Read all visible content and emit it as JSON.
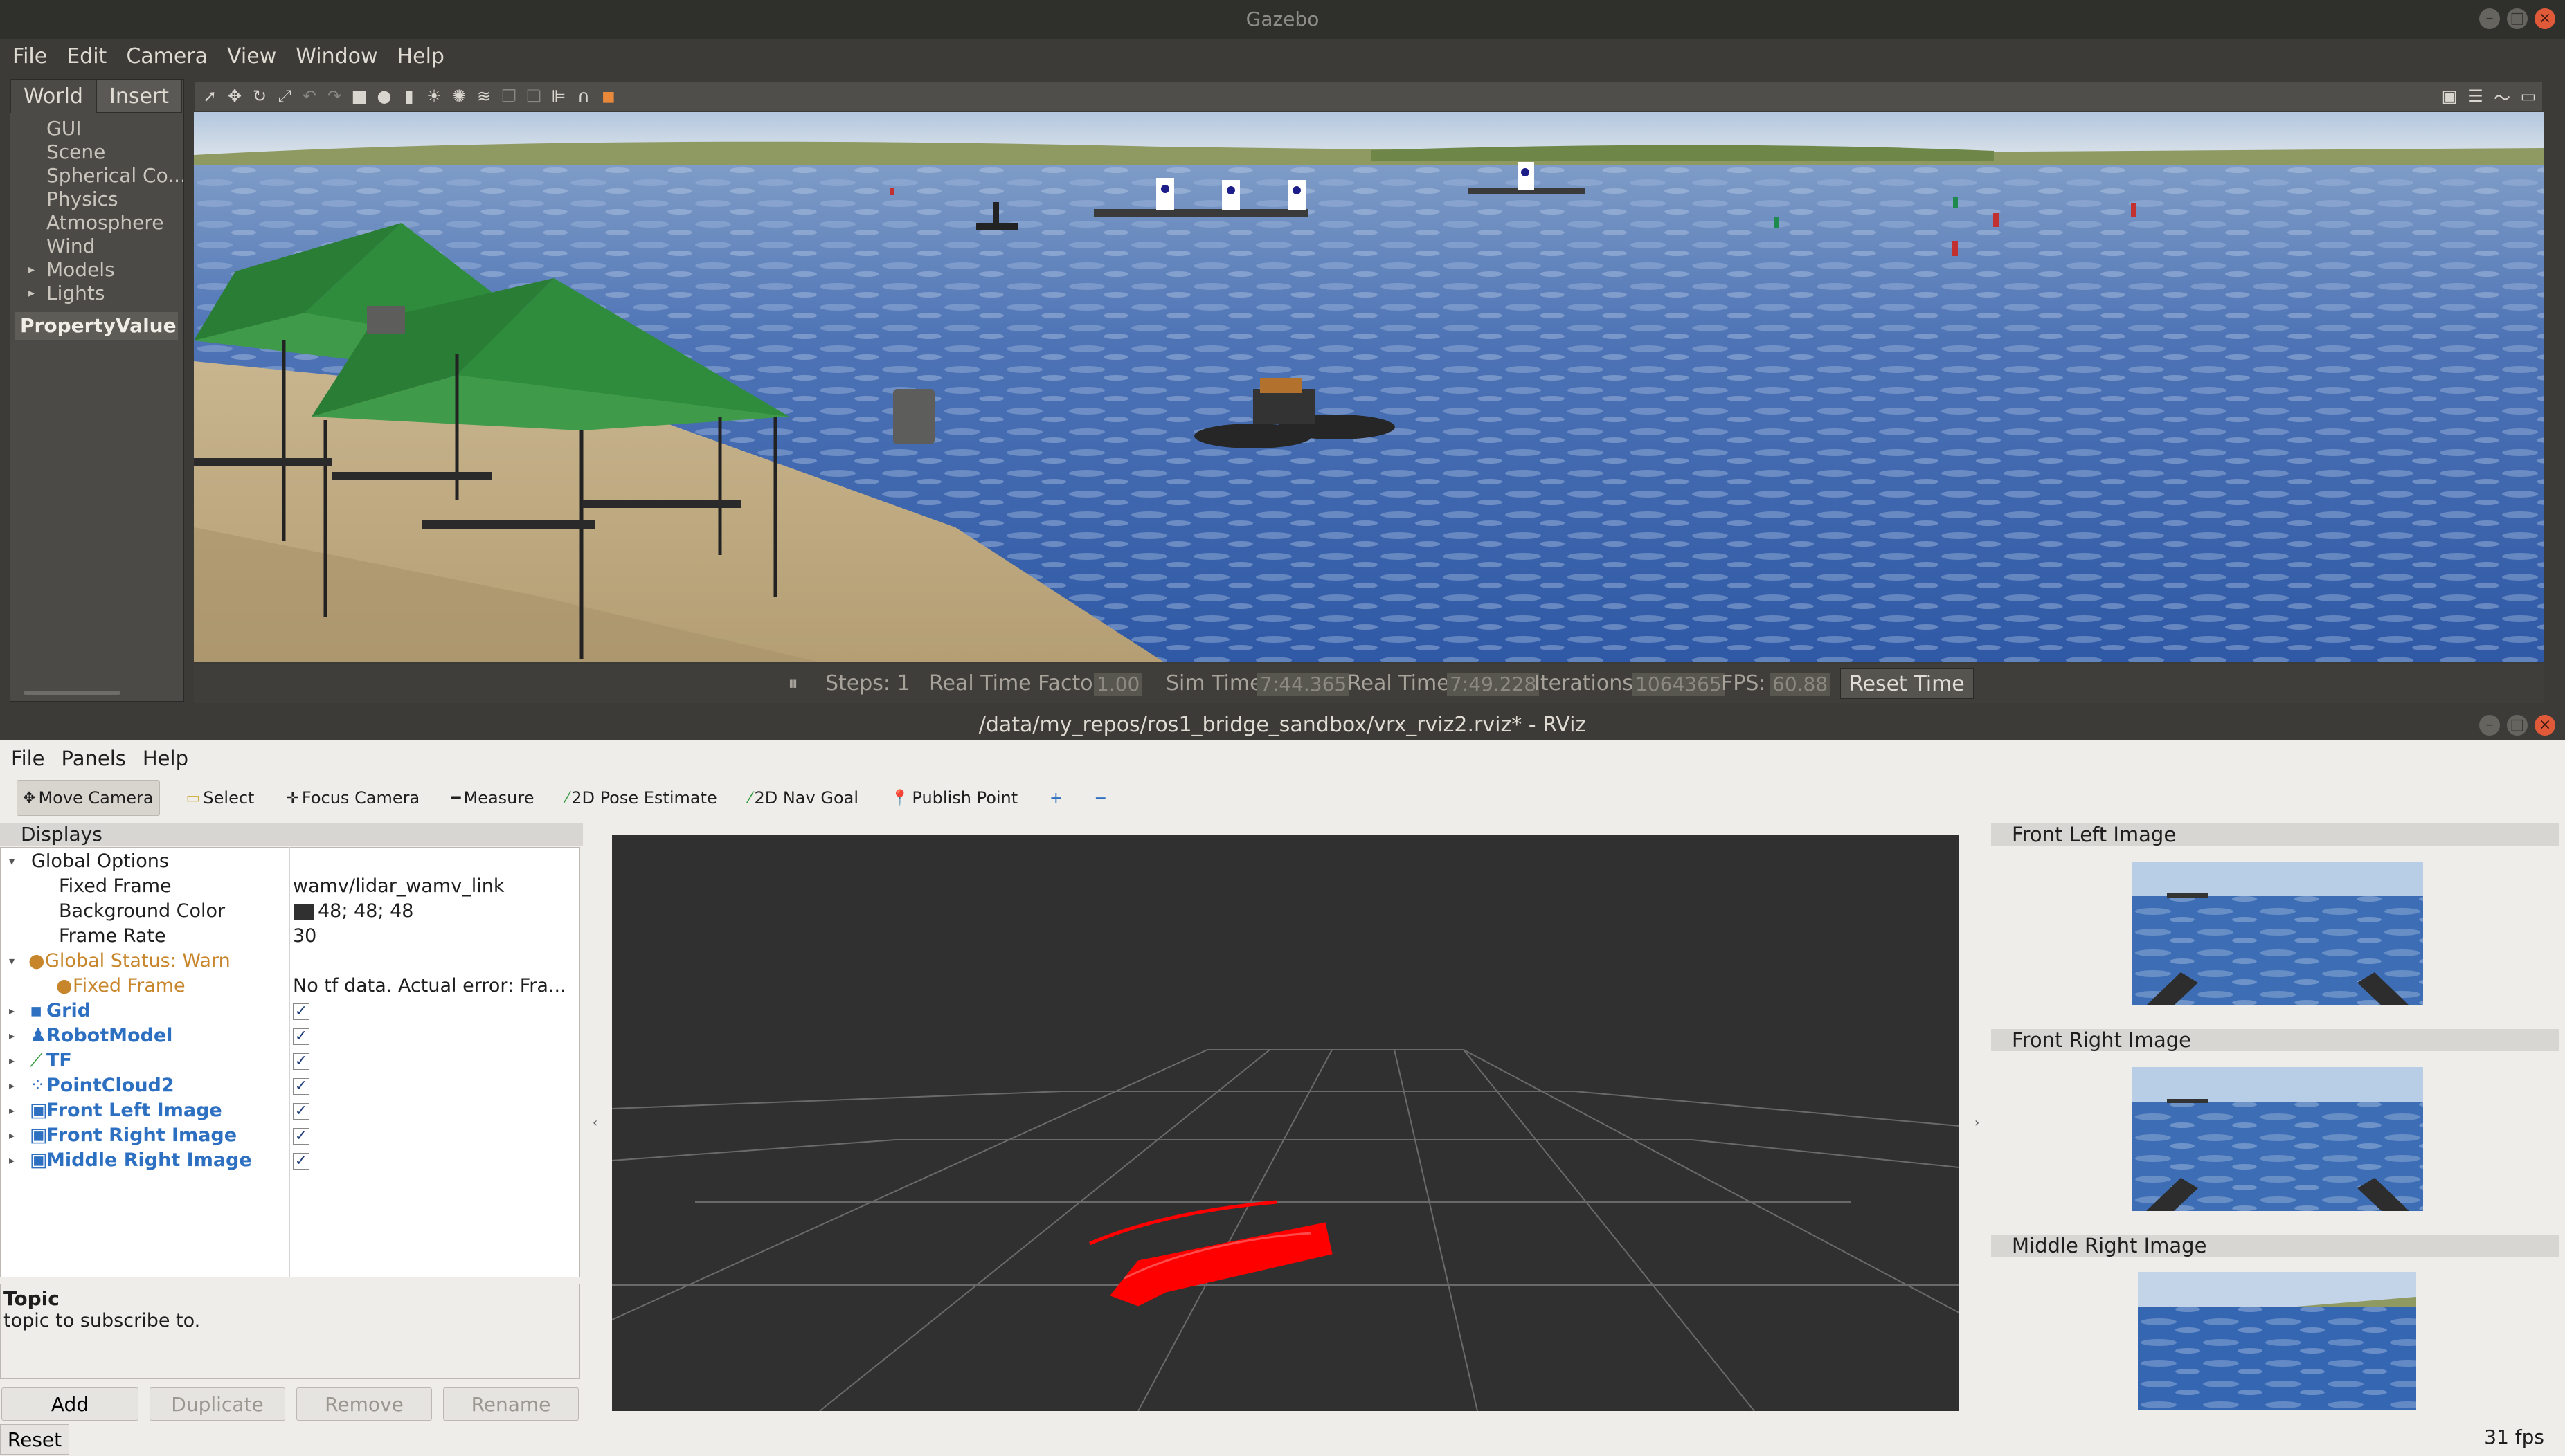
{
  "gazebo": {
    "title": "Gazebo",
    "menu": [
      "File",
      "Edit",
      "Camera",
      "View",
      "Window",
      "Help"
    ],
    "tabs": [
      "World",
      "Insert"
    ],
    "tree": [
      "GUI",
      "Scene",
      "Spherical Co...",
      "Physics",
      "Atmosphere",
      "Wind",
      "Models",
      "Lights"
    ],
    "property_header": "PropertyValue",
    "status": {
      "steps_label": "Steps: 1",
      "rtf_label": "Real Time Factor:",
      "rtf_value": "1.00",
      "sim_time_label": "Sim Time:",
      "sim_time_value": "7:44.365",
      "real_time_label": "Real Time:",
      "real_time_value": "7:49.228",
      "iterations_label": "Iterations:",
      "iterations_value": "1064365",
      "fps_label": "FPS:",
      "fps_value": "60.88",
      "reset_time": "Reset Time"
    }
  },
  "rviz": {
    "title": "/data/my_repos/ros1_bridge_sandbox/vrx_rviz2.rviz* - RViz",
    "menu": [
      "File",
      "Panels",
      "Help"
    ],
    "tools": [
      "Move Camera",
      "Select",
      "Focus Camera",
      "Measure",
      "2D Pose Estimate",
      "2D Nav Goal",
      "Publish Point"
    ],
    "displays_title": "Displays",
    "displays": {
      "global_options": "Global Options",
      "fixed_frame_label": "Fixed Frame",
      "fixed_frame_value": "wamv/lidar_wamv_link",
      "bg_color_label": "Background Color",
      "bg_color_value": "48; 48; 48",
      "frame_rate_label": "Frame Rate",
      "frame_rate_value": "30",
      "global_status": "Global Status: Warn",
      "status_fixed_frame": "Fixed Frame",
      "status_error": "No tf data.  Actual error: Fra...",
      "items": [
        "Grid",
        "RobotModel",
        "TF",
        "PointCloud2",
        "Front Left Image",
        "Front Right Image",
        "Middle Right Image"
      ]
    },
    "topic_title": "Topic",
    "topic_desc": "topic to subscribe to.",
    "buttons": [
      "Add",
      "Duplicate",
      "Remove",
      "Rename"
    ],
    "reset": "Reset",
    "fps": "31 fps",
    "panels": [
      "Front Left Image",
      "Front Right Image",
      "Middle Right Image"
    ],
    "colors": {
      "background": "#303030",
      "pointcloud": "#ff0000",
      "status_warn": "#c8862c",
      "display_link": "#2d6fc0"
    }
  }
}
